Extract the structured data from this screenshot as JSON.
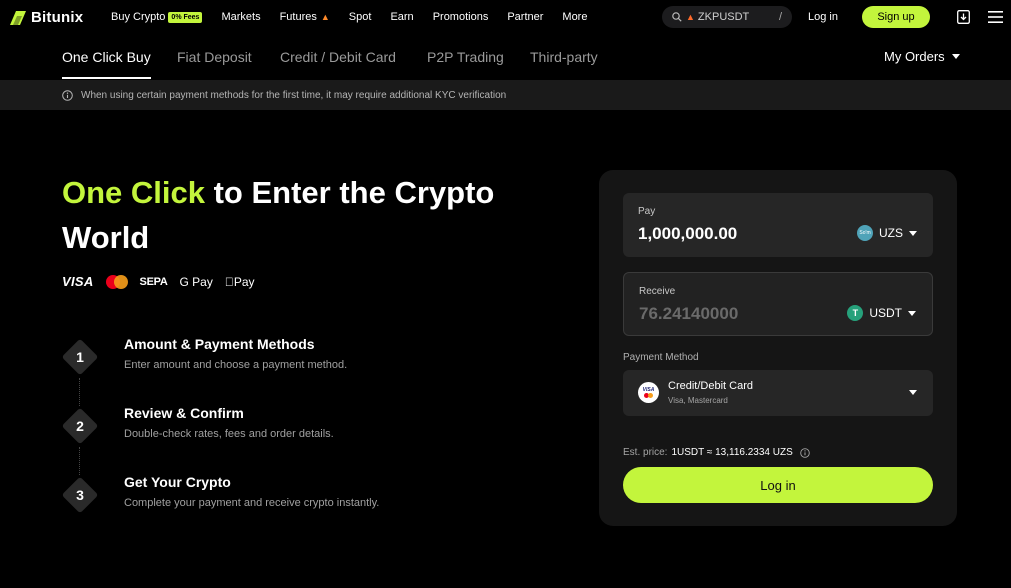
{
  "brand": {
    "name": "Bitunix"
  },
  "nav": {
    "items": [
      {
        "label": "Buy Crypto",
        "badge": "0% Fees"
      },
      {
        "label": "Markets"
      },
      {
        "label": "Futures",
        "icon": "fire-icon"
      },
      {
        "label": "Spot"
      },
      {
        "label": "Earn"
      },
      {
        "label": "Promotions"
      },
      {
        "label": "Partner"
      },
      {
        "label": "More"
      }
    ],
    "search": {
      "value": "ZKPUSDT",
      "shortcut": "/"
    },
    "login_label": "Log in",
    "signup_label": "Sign up"
  },
  "tabs": [
    {
      "label": "One Click Buy",
      "active": true
    },
    {
      "label": "Fiat Deposit"
    },
    {
      "label": "Credit / Debit Card"
    },
    {
      "label": "P2P Trading"
    },
    {
      "label": "Third-party"
    }
  ],
  "my_orders_label": "My Orders",
  "notice": "When using certain payment methods for the first time, it may require additional KYC verification",
  "hero": {
    "title_accent": "One Click",
    "title_rest": " to Enter the Crypto World",
    "payment_logos": [
      "VISA",
      "Mastercard",
      "SEPA",
      "G Pay",
      "Pay"
    ]
  },
  "steps": [
    {
      "number": "1",
      "title": "Amount & Payment Methods",
      "desc": "Enter amount and choose a payment method."
    },
    {
      "number": "2",
      "title": "Review & Confirm",
      "desc": "Double-check rates, fees and order details."
    },
    {
      "number": "3",
      "title": "Get Your Crypto",
      "desc": "Complete your payment and receive crypto instantly."
    }
  ],
  "order_card": {
    "pay": {
      "label": "Pay",
      "value": "1,000,000.00",
      "currency": "UZS",
      "currency_icon_text": "So'm"
    },
    "receive": {
      "label": "Receive",
      "value": "76.24140000",
      "currency": "USDT",
      "currency_icon_text": "T"
    },
    "payment_method": {
      "label": "Payment Method",
      "title": "Credit/Debit Card",
      "subtitle": "Visa, Mastercard",
      "icon_text": "VISA"
    },
    "est_price": {
      "label": "Est. price:",
      "value": "1USDT ≈ 13,116.2334 UZS"
    },
    "login_button": "Log in"
  },
  "colors": {
    "accent": "#c3f53c",
    "background": "#000000",
    "card": "#151515",
    "usdt": "#26a17b"
  }
}
